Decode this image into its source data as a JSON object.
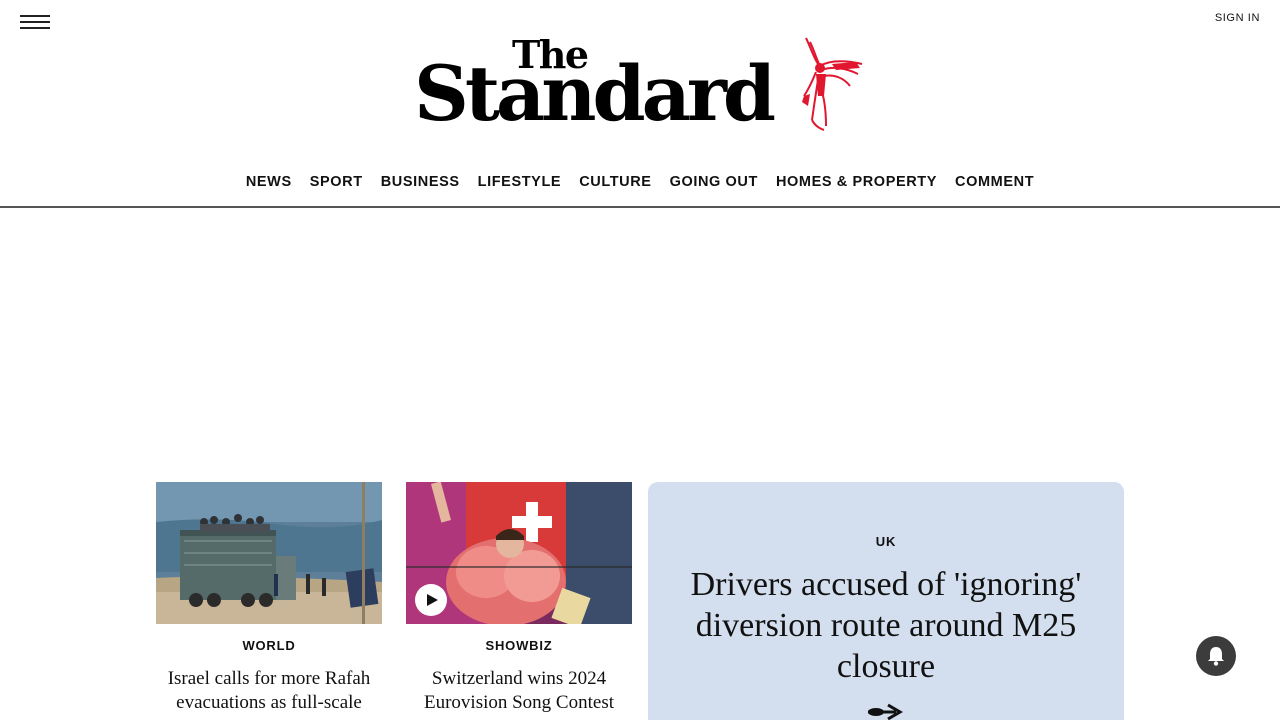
{
  "header": {
    "menu_icon": "hamburger-menu-icon",
    "sign_in": "SIGN IN",
    "logo": {
      "line1": "The",
      "line2": "Standard",
      "mark_color": "#e1172f"
    }
  },
  "nav": {
    "items": [
      {
        "label": "NEWS"
      },
      {
        "label": "SPORT"
      },
      {
        "label": "BUSINESS"
      },
      {
        "label": "LIFESTYLE"
      },
      {
        "label": "CULTURE"
      },
      {
        "label": "GOING OUT"
      },
      {
        "label": "HOMES & PROPERTY"
      },
      {
        "label": "COMMENT"
      }
    ]
  },
  "stories": [
    {
      "category": "WORLD",
      "headline": "Israel calls for more Rafah evacuations as full-scale",
      "image": "truck-on-beach-photo",
      "has_video": false
    },
    {
      "category": "SHOWBIZ",
      "headline": "Switzerland wins 2024 Eurovision Song Contest",
      "image": "eurovision-winner-photo",
      "has_video": true
    }
  ],
  "feature": {
    "category": "UK",
    "headline": "Drivers accused of 'ignoring' diversion route around M25 closure",
    "background_color": "#d3deee",
    "arrow_icon": "arrow-right-icon"
  },
  "notification": {
    "icon": "bell-icon"
  }
}
